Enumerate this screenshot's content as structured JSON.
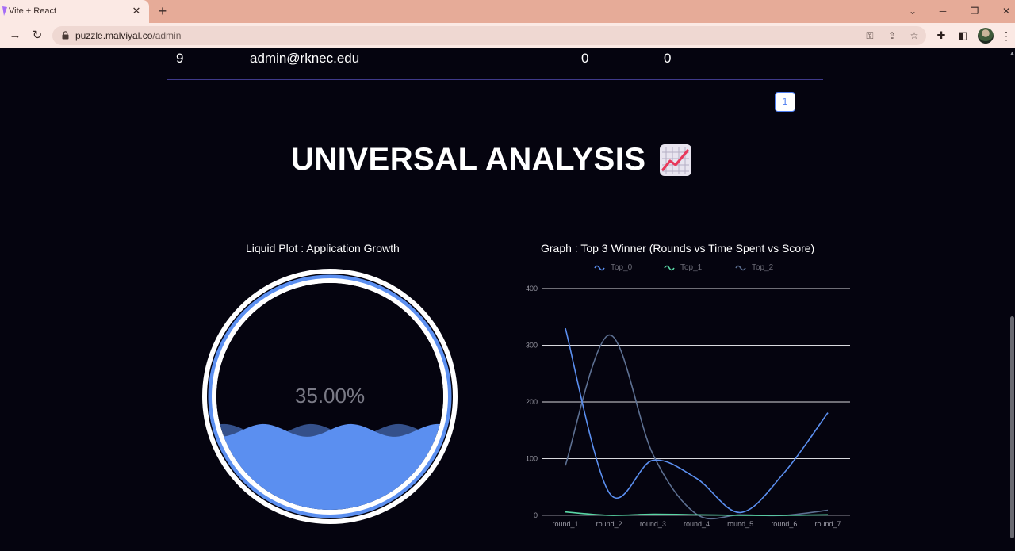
{
  "browser": {
    "tab_title": "Vite + React",
    "url_host": "puzzle.malviyal.co",
    "url_path": "/admin"
  },
  "table_row": {
    "rank": "9",
    "email": "admin@rknec.edu",
    "col3": "0",
    "col4": "0"
  },
  "pagination": {
    "current_page": "1"
  },
  "headline": "UNIVERSAL ANALYSIS",
  "headline_icon": "chart-increasing-icon",
  "liquid": {
    "title": "Liquid Plot : Application Growth",
    "percent": 0.35,
    "label": "35.00%",
    "fill_color": "#5b8ff0"
  },
  "line_chart": {
    "title": "Graph : Top 3 Winner (Rounds vs Time Spent vs Score)"
  },
  "chart_data": {
    "type": "line",
    "categories": [
      "round_1",
      "round_2",
      "round_3",
      "round_4",
      "round_5",
      "round_6",
      "round_7"
    ],
    "series": [
      {
        "name": "Top_0",
        "color": "#5b8ff0",
        "values": [
          330,
          40,
          97,
          65,
          5,
          75,
          181
        ]
      },
      {
        "name": "Top_1",
        "color": "#5ad8a6",
        "values": [
          6,
          0,
          2,
          1,
          0,
          0,
          1
        ]
      },
      {
        "name": "Top_2",
        "color": "#5d7092",
        "values": [
          88,
          318,
          108,
          2,
          1,
          0,
          9
        ]
      }
    ],
    "yticks": [
      0,
      100,
      200,
      300,
      400
    ],
    "ylim": [
      0,
      400
    ],
    "grid": true,
    "legend_position": "top"
  }
}
